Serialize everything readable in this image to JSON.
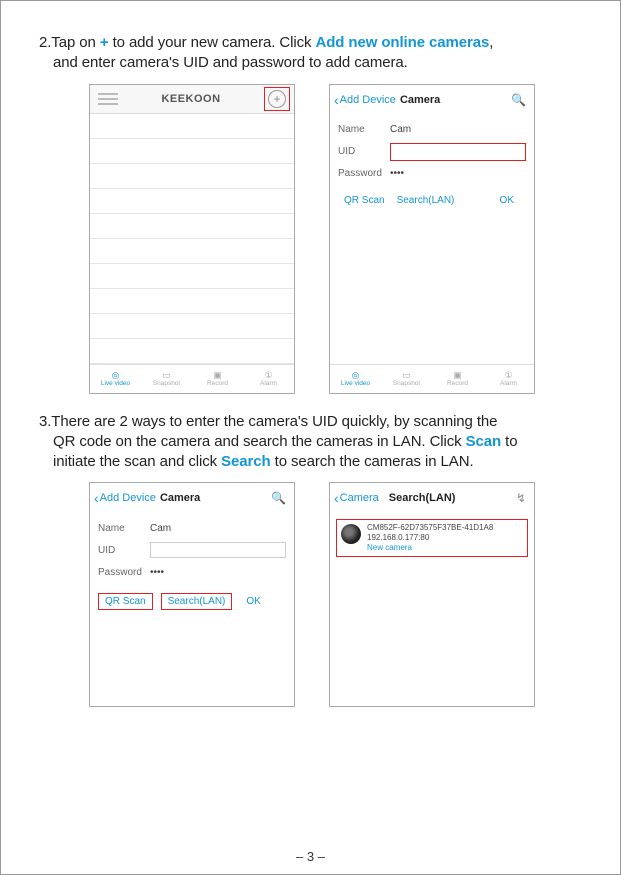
{
  "step2": {
    "prefix": "2.Tap on ",
    "plus": "+",
    "mid": " to add your new camera. Click ",
    "highlight": "Add new online cameras",
    "suffix": ",",
    "line2": "and enter camera's UID and password to add camera."
  },
  "step3": {
    "l1a": "3.There are 2 ways to enter the camera's UID quickly, by scanning the",
    "l2a": "QR code on the camera and search the cameras in LAN. Click ",
    "scan": "Scan",
    "l2b": " to",
    "l3a": "initiate the scan and click ",
    "search": "Search",
    "l3b": " to search the cameras in LAN."
  },
  "brand": "KEEKOON",
  "add_device": {
    "back": "Add Device",
    "title": "Camera",
    "name_label": "Name",
    "name_val": "Cam",
    "uid_label": "UID",
    "pwd_label": "Password",
    "pwd_val": "••••",
    "qr": "QR Scan",
    "searchlan": "Search(LAN)",
    "ok": "OK"
  },
  "lan": {
    "back": "Camera",
    "title": "Search(LAN)",
    "uid": "CM852F-62D73575F37BE-41D1A8",
    "ip": "192.168.0.177:80",
    "new": "New camera"
  },
  "tabs": {
    "live": "Live video",
    "snap": "Snapshot",
    "rec": "Record",
    "alarm": "Alarm"
  },
  "pagenum": "– 3 –"
}
